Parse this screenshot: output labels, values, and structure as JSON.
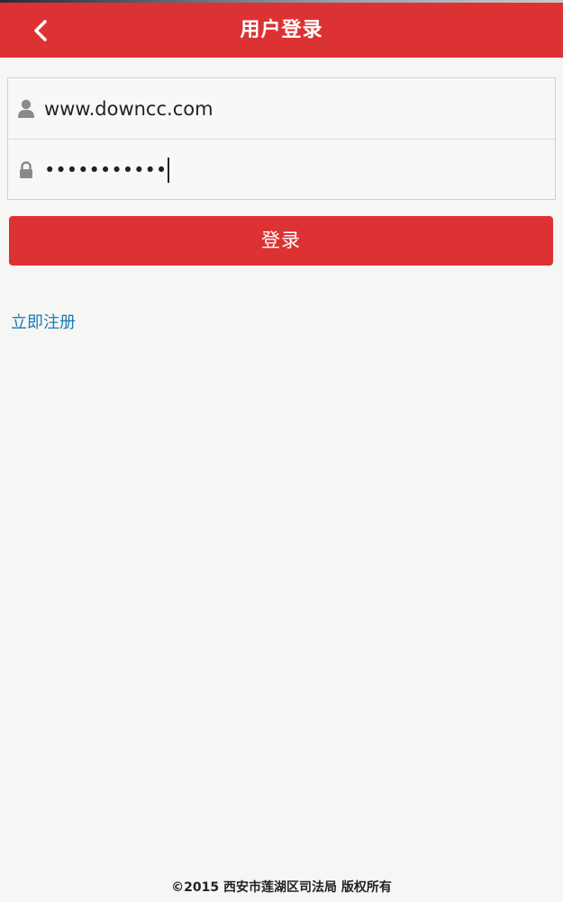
{
  "header": {
    "title": "用户登录",
    "back_icon": "chevron-left-icon",
    "background_color": "#dd3233"
  },
  "form": {
    "username": {
      "icon": "user-icon",
      "value": "www.downcc.com"
    },
    "password": {
      "icon": "lock-icon",
      "masked_value": "•••••••••••"
    }
  },
  "login_button": {
    "label": "登录",
    "color": "#dd3233"
  },
  "register_link": {
    "label": "立即注册",
    "color": "#1a7ab8"
  },
  "footer": {
    "text": "©2015 西安市莲湖区司法局 版权所有"
  }
}
